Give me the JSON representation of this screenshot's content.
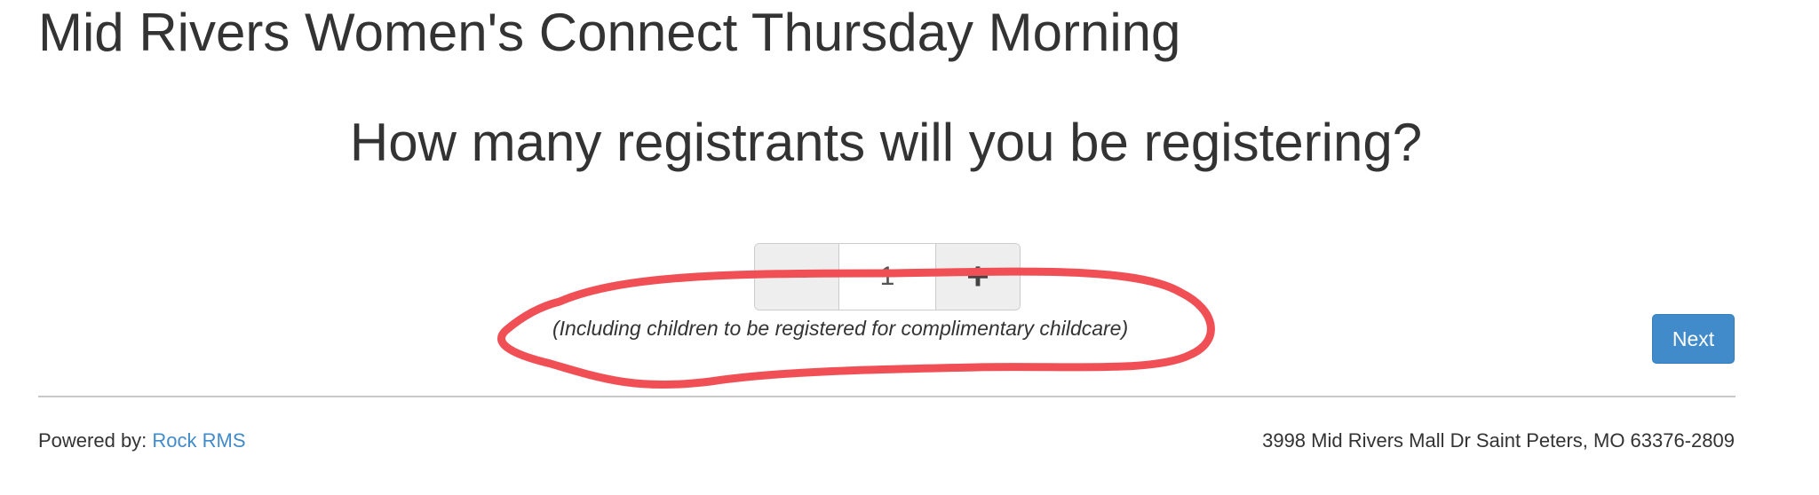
{
  "event": {
    "title": "Mid Rivers Women's Connect Thursday Morning"
  },
  "registration": {
    "question": "How many registrants will you be registering?",
    "count_value": "1",
    "decrement_label": "−",
    "increment_label": "+",
    "hint": "(Including children to be registered for complimentary childcare)",
    "next_label": "Next"
  },
  "footer": {
    "powered_by_label": "Powered by:",
    "powered_by_link": "Rock RMS",
    "address": "3998 Mid Rivers Mall Dr Saint Peters, MO 63376-2809"
  },
  "colors": {
    "primary": "#428bca",
    "annotation": "#f05055",
    "text": "#333333"
  }
}
